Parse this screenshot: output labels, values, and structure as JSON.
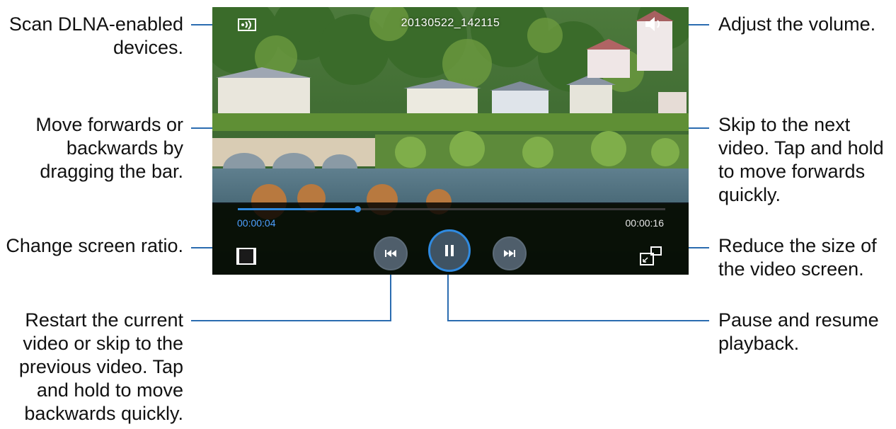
{
  "video": {
    "title": "20130522_142115",
    "current_time": "00:00:04",
    "total_time": "00:00:16",
    "progress": 0.28,
    "accent_color": "#2f8ae0",
    "state": "playing"
  },
  "controls": {
    "dlna_icon": "dlna-scan-icon",
    "volume_icon": "speaker-icon",
    "ratio_icon": "screen-ratio-icon",
    "prev_icon": "skip-previous-icon",
    "pause_icon": "pause-icon",
    "next_icon": "skip-next-icon",
    "popup_icon": "pop-up-play-icon"
  },
  "callouts": {
    "scan_dlna": [
      "Scan DLNA-enabled",
      "devices."
    ],
    "seek_bar": [
      "Move forwards or",
      "backwards by",
      "dragging the bar."
    ],
    "screen_ratio": [
      "Change screen ratio."
    ],
    "previous": [
      "Restart the current",
      "video or skip to the",
      "previous video. Tap",
      "and hold to move",
      "backwards quickly."
    ],
    "volume": [
      "Adjust the volume."
    ],
    "next": [
      "Skip to the next",
      "video. Tap and hold",
      "to move forwards",
      "quickly."
    ],
    "reduce_size": [
      "Reduce the size of",
      "the video screen."
    ],
    "pause": [
      "Pause and resume",
      "playback."
    ]
  }
}
